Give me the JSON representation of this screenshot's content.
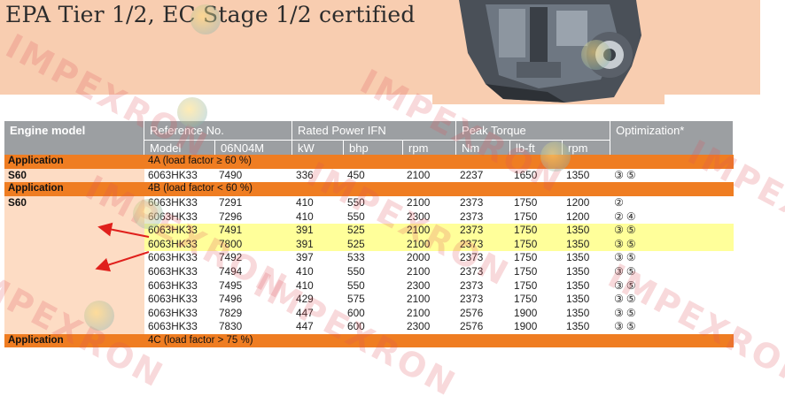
{
  "banner": {
    "title": "EPA Tier 1/2, EC Stage 1/2 certified"
  },
  "table": {
    "headers": {
      "engine_model": "Engine model",
      "reference_no": "Reference No.",
      "rated_power": "Rated Power IFN",
      "peak_torque": "Peak Torque",
      "optimization": "Optimization*",
      "model": "Model",
      "code": "06N04M",
      "kw": "kW",
      "bhp": "bhp",
      "rpm": "rpm",
      "nm": "Nm",
      "lbft": "lb-ft",
      "rpm2": "rpm"
    },
    "application_label": "Application",
    "application_4a": "4A (load factor ≥ 60 %)",
    "application_4b": "4B (load factor < 60 %)",
    "application_4c": "4C (load factor > 75 %)",
    "engine_s60": "S60",
    "rows_4a": [
      {
        "model": "6063HK33",
        "ref": "7490",
        "kw": "336",
        "bhp": "450",
        "rpm": "2100",
        "nm": "2237",
        "lbft": "1650",
        "trpm": "1350",
        "opt": "③ ⑤"
      }
    ],
    "rows_4b": [
      {
        "model": "6063HK33",
        "ref": "7291",
        "kw": "410",
        "bhp": "550",
        "rpm": "2100",
        "nm": "2373",
        "lbft": "1750",
        "trpm": "1200",
        "opt": "②"
      },
      {
        "model": "6063HK33",
        "ref": "7296",
        "kw": "410",
        "bhp": "550",
        "rpm": "2300",
        "nm": "2373",
        "lbft": "1750",
        "trpm": "1200",
        "opt": "② ④"
      },
      {
        "model": "6063HK33",
        "ref": "7491",
        "kw": "391",
        "bhp": "525",
        "rpm": "2100",
        "nm": "2373",
        "lbft": "1750",
        "trpm": "1350",
        "opt": "③ ⑤"
      },
      {
        "model": "6063HK33",
        "ref": "7800",
        "kw": "391",
        "bhp": "525",
        "rpm": "2100",
        "nm": "2373",
        "lbft": "1750",
        "trpm": "1350",
        "opt": "③ ⑤"
      },
      {
        "model": "6063HK33",
        "ref": "7492",
        "kw": "397",
        "bhp": "533",
        "rpm": "2000",
        "nm": "2373",
        "lbft": "1750",
        "trpm": "1350",
        "opt": "③ ⑤"
      },
      {
        "model": "6063HK33",
        "ref": "7494",
        "kw": "410",
        "bhp": "550",
        "rpm": "2100",
        "nm": "2373",
        "lbft": "1750",
        "trpm": "1350",
        "opt": "③ ⑤"
      },
      {
        "model": "6063HK33",
        "ref": "7495",
        "kw": "410",
        "bhp": "550",
        "rpm": "2300",
        "nm": "2373",
        "lbft": "1750",
        "trpm": "1350",
        "opt": "③ ⑤"
      },
      {
        "model": "6063HK33",
        "ref": "7496",
        "kw": "429",
        "bhp": "575",
        "rpm": "2100",
        "nm": "2373",
        "lbft": "1750",
        "trpm": "1350",
        "opt": "③ ⑤"
      },
      {
        "model": "6063HK33",
        "ref": "7829",
        "kw": "447",
        "bhp": "600",
        "rpm": "2100",
        "nm": "2576",
        "lbft": "1900",
        "trpm": "1350",
        "opt": "③ ⑤"
      },
      {
        "model": "6063HK33",
        "ref": "7830",
        "kw": "447",
        "bhp": "600",
        "rpm": "2300",
        "nm": "2576",
        "lbft": "1900",
        "trpm": "1350",
        "opt": "③ ⑤"
      }
    ],
    "highlighted_refs": [
      "7491",
      "7800"
    ]
  },
  "watermark": "IMPEXRON",
  "colors": {
    "banner_bg": "#f8cdb0",
    "header_gray": "#9c9fa2",
    "application_orange": "#ef7d22",
    "model_column_peach": "#fddcc4",
    "highlight_yellow": "#ffff9a",
    "arrow_red": "#e0201c"
  }
}
